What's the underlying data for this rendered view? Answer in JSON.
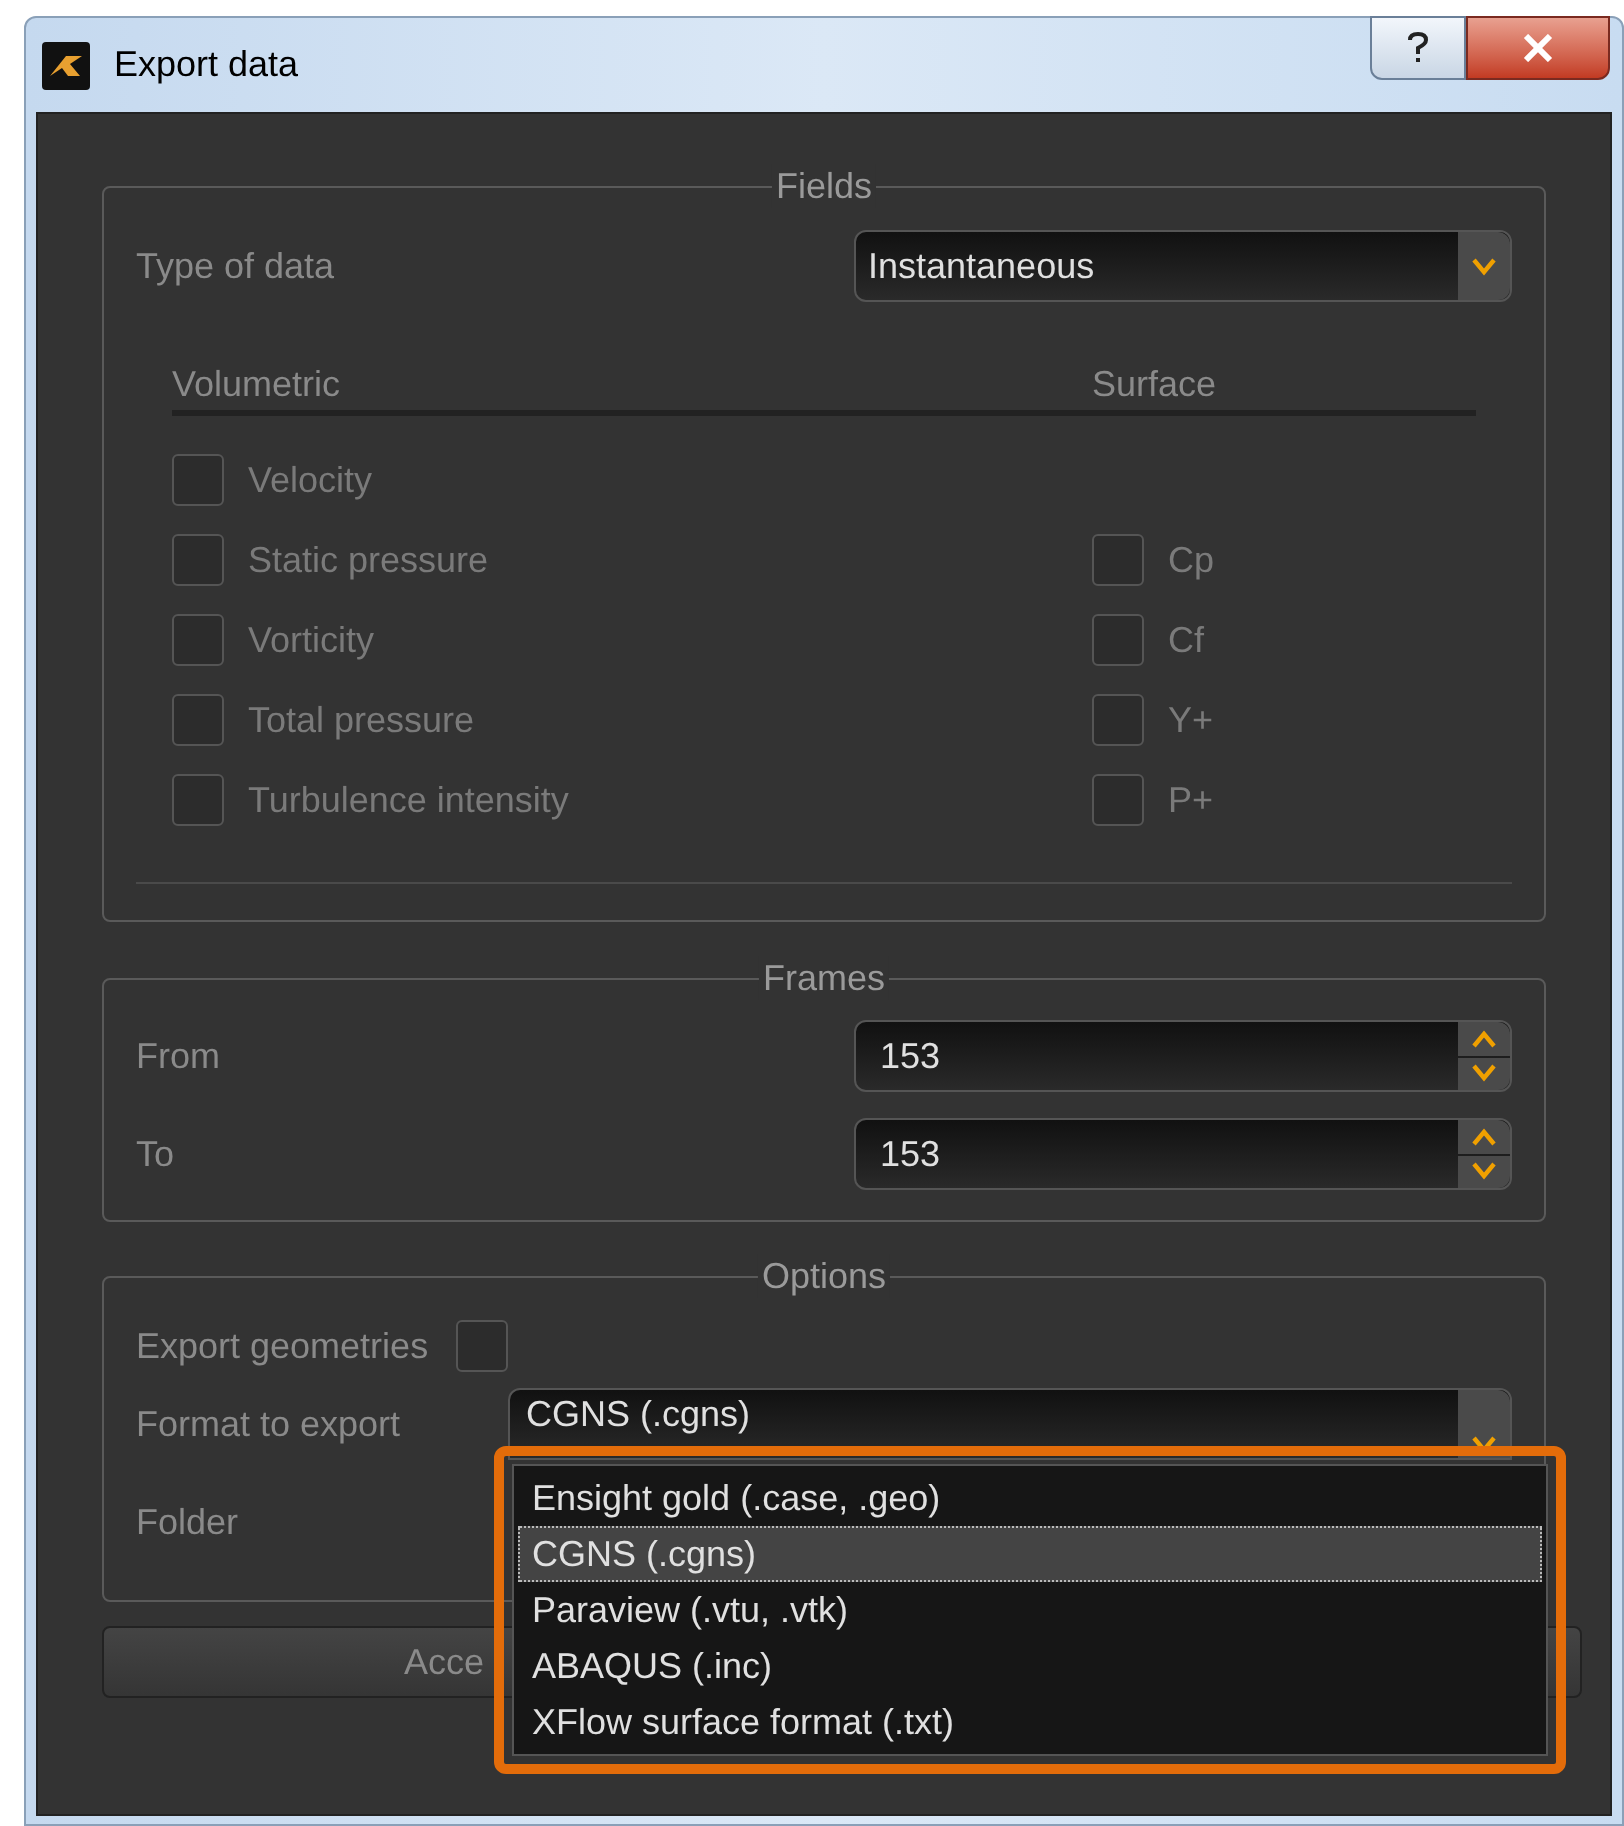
{
  "window": {
    "title": "Export data"
  },
  "fields": {
    "title": "Fields",
    "type_of_data": {
      "label": "Type of data",
      "value": "Instantaneous"
    },
    "volumetric": {
      "heading": "Volumetric",
      "items": [
        {
          "label": "Velocity",
          "checked": false
        },
        {
          "label": "Static pressure",
          "checked": false
        },
        {
          "label": "Vorticity",
          "checked": false
        },
        {
          "label": "Total pressure",
          "checked": false
        },
        {
          "label": "Turbulence intensity",
          "checked": false
        }
      ]
    },
    "surface": {
      "heading": "Surface",
      "items": [
        {
          "label": "Cp",
          "checked": false
        },
        {
          "label": "Cf",
          "checked": false
        },
        {
          "label": "Y+",
          "checked": false
        },
        {
          "label": "P+",
          "checked": false
        }
      ]
    }
  },
  "frames": {
    "title": "Frames",
    "rows": [
      {
        "label": "From",
        "value": "153"
      },
      {
        "label": "To",
        "value": "153"
      }
    ]
  },
  "options": {
    "title": "Options",
    "export_geometries": {
      "label": "Export geometries",
      "checked": false
    },
    "format": {
      "label": "Format to export",
      "value": "CGNS (.cgns)",
      "expanded": true,
      "options": [
        {
          "label": "Ensight gold (.case, .geo)",
          "selected": false
        },
        {
          "label": "CGNS (.cgns)",
          "selected": true
        },
        {
          "label": "Paraview (.vtu, .vtk)",
          "selected": false
        },
        {
          "label": "ABAQUS (.inc)",
          "selected": false
        },
        {
          "label": "XFlow surface format (.txt)",
          "selected": false
        }
      ]
    },
    "folder": {
      "label": "Folder"
    }
  },
  "accept_button": {
    "label": "Acce"
  }
}
